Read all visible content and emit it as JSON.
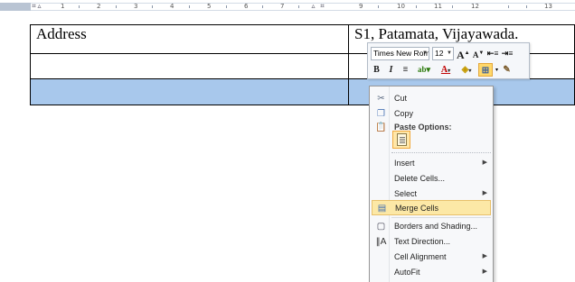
{
  "ruler": {
    "numbers": [
      "1",
      "2",
      "3",
      "4",
      "5",
      "6",
      "7",
      "9",
      "10",
      "11",
      "12",
      "13"
    ]
  },
  "table": {
    "rows": [
      [
        "Address",
        "S1, Patamata, Vijayawada."
      ],
      [
        "",
        ""
      ],
      [
        "",
        ""
      ]
    ]
  },
  "mini_toolbar": {
    "font_name": "Times New Rom",
    "font_size": "12",
    "grow_font": "A",
    "shrink_font": "A",
    "bold": "B",
    "italic": "I",
    "font_color": "A",
    "highlight_color": "#ffd86a"
  },
  "context_menu": {
    "cut": "Cut",
    "copy": "Copy",
    "paste_options": "Paste Options:",
    "insert": "Insert",
    "delete_cells": "Delete Cells...",
    "select": "Select",
    "merge_cells": "Merge Cells",
    "borders_shading": "Borders and Shading...",
    "text_direction": "Text Direction...",
    "cell_alignment": "Cell Alignment",
    "autofit": "AutoFit"
  }
}
